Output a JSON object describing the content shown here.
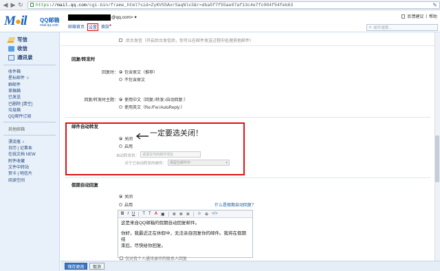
{
  "browser": {
    "url_scheme": "https",
    "url_host": "://mail.qq.com",
    "url_path": "/cgi-bin/frame_html?sid=ZyKVSSAxrSaqNlx3&r=dba5f7f55ae07af13c4e7fc004f54feb63"
  },
  "header": {
    "logo_text": "Mail",
    "logo_cn": "QQ邮箱",
    "logo_url": "mail.qq.com",
    "account_suffix": "@qq.com> ▾",
    "links": [
      {
        "label": "邮箱首页"
      },
      {
        "label": "设置"
      },
      {
        "label": "换肤",
        "badge": "●"
      }
    ],
    "top_links": [
      "反馈建议",
      "帮助"
    ],
    "search_placeholder": "邮件搜索..."
  },
  "sidebar": {
    "primary": [
      "写信",
      "收信",
      "通讯录"
    ],
    "folders": [
      "收件箱",
      "星标邮件 ☆",
      "群邮件",
      "草稿箱",
      "已发送",
      "已删除  [清空]",
      "垃圾箱",
      "QQ邮件订阅"
    ],
    "other_title": "其他邮箱",
    "apps": [
      "漂流瓶 ♁",
      "日历 | 记事本",
      "在线文档 NEW",
      "附件收藏",
      "文件中转站",
      "贺卡 | 明信片",
      "阅读空间"
    ]
  },
  "settings": {
    "top_checkbox": "后台发信（开启后台发信后，你可以在邮件发送过程中处理其他邮件）",
    "reply_section": "回复/转发时",
    "reply_label": "回复时：",
    "reply_opt1": "包含原文（推荐）",
    "reply_opt2": "不包含原文",
    "subject_label": "回复/转发时主题：",
    "subject_opt1": "使用中文（回复:/转发:/自动回复:）",
    "subject_opt2": "使用英文（Re:/Fw:/AutoReply:）",
    "forward_section": "邮件自动转发",
    "forward_off": "关闭",
    "forward_on": "启用",
    "forward_to_label": "自动转发到：",
    "forward_to_placeholder": "请填写你的邮件地址",
    "forward_handle_label": "对于已自动转发的邮件：",
    "forward_handle_value": "保留在邮件中",
    "annotation": "一定要选关闭！",
    "vacation_section": "假期自动回复",
    "vac_off": "关闭",
    "vac_on": "启用",
    "vac_help": "什么是假期自动回复？",
    "editor_toolbar": [
      "B",
      "I",
      "U",
      "T",
      "T",
      "A",
      "▣",
      "≣",
      "≣",
      "≣",
      "☺",
      "⊕",
      "</>"
    ],
    "editor_line1": "这是来自QQ邮箱的假期自动回复邮件。",
    "editor_line2": "你好，我最近正在休假中，无法亲自回复你的邮件。我将在假期结",
    "editor_line3": "束后，尽快给你回复。",
    "cut_text": "仅对我个人通讯录中的联系人回复"
  },
  "footer": {
    "save": "保存更改",
    "cancel": "取消"
  }
}
